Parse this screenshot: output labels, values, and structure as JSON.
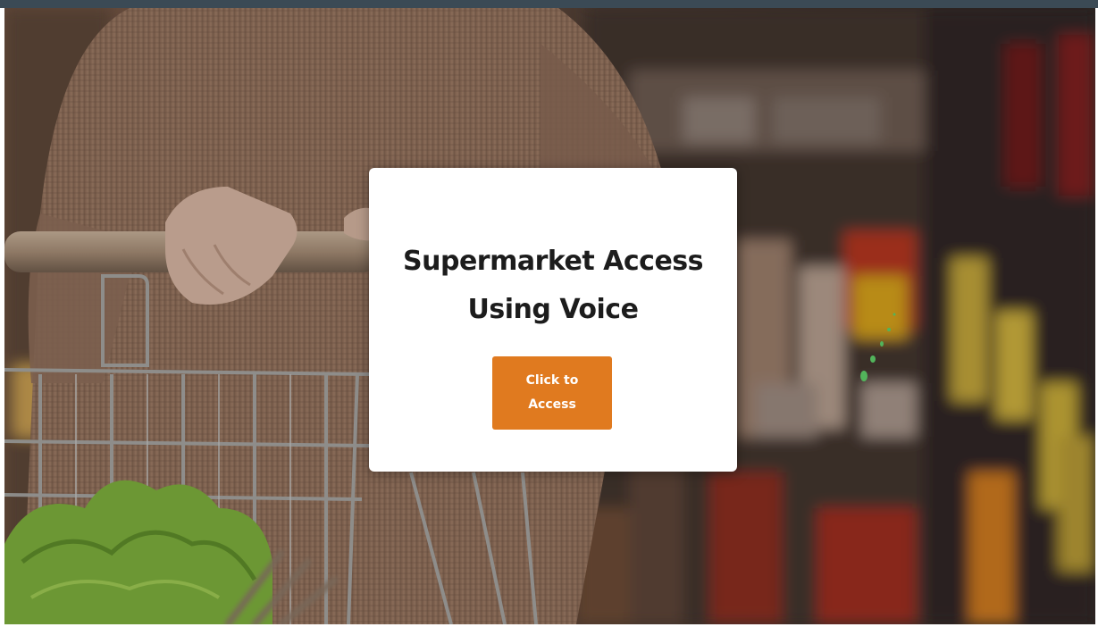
{
  "modal": {
    "title": "Supermarket Access Using Voice",
    "button_label": "Click to Access"
  },
  "colors": {
    "top_bar": "#3b4a55",
    "button_background": "#e07a1f",
    "button_text": "#ffffff",
    "title_text": "#1c1c1c",
    "modal_background": "#ffffff"
  },
  "background": {
    "image": "shopper-pushing-cart-in-supermarket-aisle-photo"
  }
}
